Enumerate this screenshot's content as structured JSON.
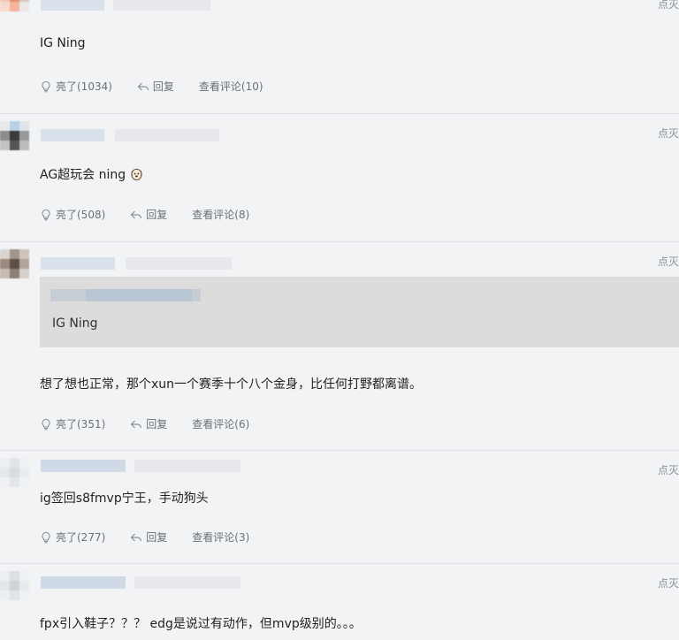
{
  "comments": [
    {
      "report": "点灭",
      "text": "IG Ning",
      "like": "亮了(1034)",
      "reply": "回复",
      "view": "查看评论(10)"
    },
    {
      "report": "点灭",
      "text": "AG超玩会 ning",
      "emoji": "dog-face-emoji",
      "like": "亮了(508)",
      "reply": "回复",
      "view": "查看评论(8)"
    },
    {
      "report": "点灭",
      "quote_text": "IG Ning",
      "text": "想了想也正常，那个xun一个赛季十个八个金身，比任何打野都离谱。",
      "like": "亮了(351)",
      "reply": "回复",
      "view": "查看评论(6)"
    },
    {
      "report": "点灭",
      "text": "ig签回s8fmvp宁王，手动狗头",
      "like": "亮了(277)",
      "reply": "回复",
      "view": "查看评论(3)"
    },
    {
      "report": "点灭",
      "text": "fpx引入鞋子？？？ edg是说过有动作，但mvp级别的。。。"
    }
  ],
  "icons": {
    "like": "lightbulb-icon",
    "reply": "reply-arrow-icon"
  }
}
